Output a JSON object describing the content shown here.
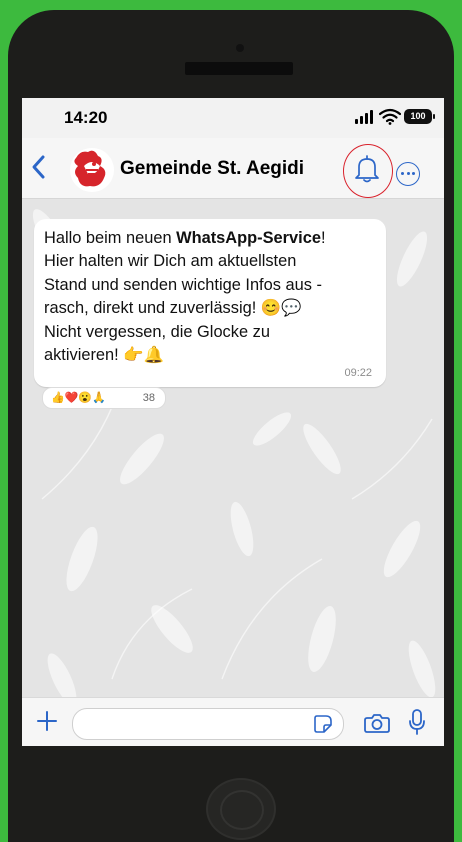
{
  "status_bar": {
    "time": "14:20",
    "battery": "100"
  },
  "header": {
    "title": "Gemeinde St. Aegidi"
  },
  "message": {
    "line1_pre": "Hallo beim neuen ",
    "line1_bold": "WhatsApp-Service",
    "line1_post": "!",
    "line2": "Hier halten wir Dich am aktuellsten",
    "line3": "Stand und senden wichtige Infos aus -",
    "line4": "rasch, direkt und zuverlässig! 😊💬",
    "line5": "Nicht vergessen, die Glocke zu",
    "line6": "aktivieren! 👉🔔",
    "time": "09:22"
  },
  "reactions": {
    "emojis": "👍❤️😮🙏",
    "count": "38"
  },
  "colors": {
    "accent_blue": "#2c66c8",
    "highlight_red": "#d9232d",
    "background_green": "#3dba3e"
  }
}
